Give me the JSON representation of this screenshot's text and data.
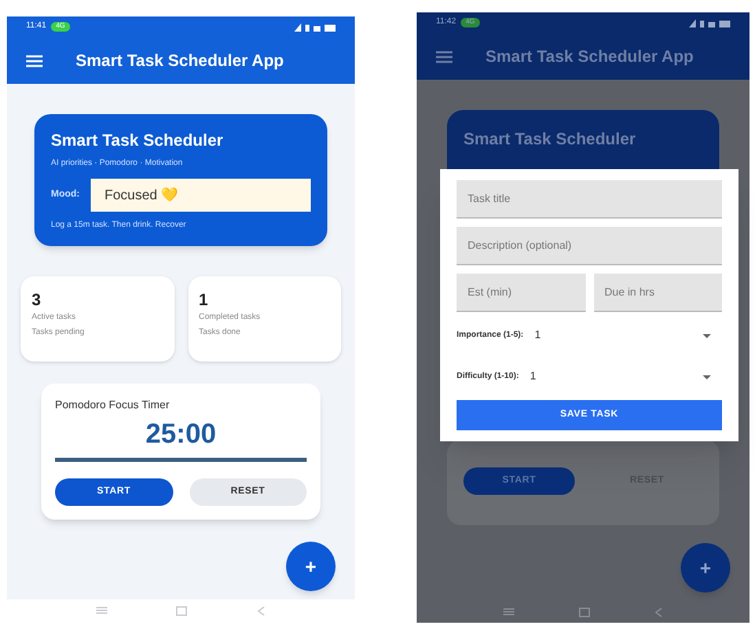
{
  "home_screen": {
    "status_bar": {
      "time": "11:41",
      "badge": "4G"
    },
    "app_bar": {
      "title": "Smart Task Scheduler App"
    },
    "header_card": {
      "title": "Smart Task Scheduler",
      "subtitle": "AI priorities · Pomodoro · Motivation",
      "mood_label": "Mood:",
      "mood_value": "Focused 💛",
      "hint": "Log a 15m task. Then drink. Recover"
    },
    "stats": [
      {
        "value": "3",
        "label": "Active tasks",
        "caption": "Tasks pending"
      },
      {
        "value": "1",
        "label": "Completed tasks",
        "caption": "Tasks done"
      }
    ],
    "timer": {
      "title": "Pomodoro Focus Timer",
      "time": "25:00",
      "level": 1,
      "buttons": [
        {
          "label": "START",
          "kind": "primary"
        },
        {
          "label": "RESET",
          "kind": "secondary"
        }
      ]
    },
    "fab": {
      "label": "+"
    }
  },
  "dialog_screen": {
    "status_bar": {
      "time": "11:42",
      "badge": "4G"
    },
    "app_bar": {
      "title": "Smart Task Scheduler App"
    },
    "header_card": {
      "title": "Smart Task Scheduler"
    },
    "dialog": {
      "fields": [
        {
          "placeholder": "Task title",
          "kind": "full"
        },
        {
          "placeholder": "Description (optional)",
          "kind": "full"
        },
        {
          "placeholder": "Est (min)",
          "kind": "half"
        },
        {
          "placeholder": "Due in hrs",
          "kind": "half"
        }
      ],
      "selects": [
        {
          "label": "Importance (1-5):",
          "value": "1"
        },
        {
          "label": "Difficulty (1-10):",
          "value": "1"
        }
      ],
      "save_button": "SAVE TASK"
    },
    "behind_buttons": [
      "START",
      "RESET"
    ],
    "fab": {
      "label": "+"
    }
  }
}
